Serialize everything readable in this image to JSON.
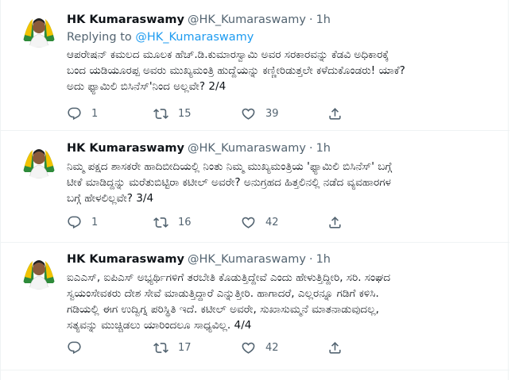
{
  "tweets": [
    {
      "name": "HK Kumaraswamy",
      "handle": "@HK_Kumaraswamy",
      "dot": "·",
      "time": "1h",
      "replying_prefix": "Replying to",
      "replying_to": "@HK_Kumaraswamy",
      "text": "ಆಪರೇಷನ್ ಕಮಲದ ಮೂಲಕ ಹೆಚ್.ಡಿ.ಕುಮಾರಸ್ವಾಮಿ ಅವರ ಸರಕಾರವನ್ನು ಕೆಡವಿ ಅಧಿಕಾರಕ್ಕೆ\nಬಂದ ಯಡಿಯೂರಪ್ಪ ಅವರು ಮುಖ್ಯಮಂತ್ರಿ ಹುದ್ದೆಯನ್ನು ಕಣ್ಣೀರಿಡುತ್ತಲೇ ಕಳೆದುಕೊಂಡರು! ಯಾಕೆ?\nಅದು ಫ್ಯಾಮಿಲಿ ಬಿಸಿನೆಸ್'ನಿಂದ ಅಲ್ಲವೇ? 2/4",
      "replies": "1",
      "retweets": "15",
      "likes": "39"
    },
    {
      "name": "HK Kumaraswamy",
      "handle": "@HK_Kumaraswamy",
      "dot": "·",
      "time": "1h",
      "text": "ನಿಮ್ಮ ಪಕ್ಷದ ಶಾಸಕರೇ ಹಾದಿಬೀದಿಯಲ್ಲಿ ನಿಂತು ನಿಮ್ಮ ಮುಖ್ಯಮಂತ್ರಿಯ 'ಫ್ಯಾಮಿಲಿ ಬಿಸಿನೆಸ್' ಬಗ್ಗೆ\nಟೀಕೆ ಮಾಡಿದ್ದನ್ನು ಮರೆತುಬಿಟ್ಟಿರಾ ಕಟೀಲ್ ಅವರೇ? ಅನುಗ್ರಹದ ಹಿತ್ತಲಿನಲ್ಲಿ ನಡೆದ ವ್ಯವಹಾರಗಳ\nಬಗ್ಗೆ ಹೇಳಲಿಲ್ಲವೇ? 3/4",
      "replies": "1",
      "retweets": "16",
      "likes": "42"
    },
    {
      "name": "HK Kumaraswamy",
      "handle": "@HK_Kumaraswamy",
      "dot": "·",
      "time": "1h",
      "text": "ಐಎಎಸ್, ಐಪಿಎಸ್ ಅಭ್ಯರ್ಥಿಗಳಿಗೆ ತರಬೇತಿ ಕೊಡುತ್ತಿದ್ದೇವೆ ಎಂದು ಹೇಳುತ್ತಿದ್ದೀರಿ, ಸರಿ. ಸಂಘದ\nಸ್ವಯಂಸೇವಕರು ದೇಶ ಸೇವೆ ಮಾಡುತ್ತಿದ್ದಾರೆ ಎನ್ನುತ್ತೀರಿ. ಹಾಗಾದರೆ, ಎಲ್ಲರನ್ನೂ ಗಡಿಗೆ ಕಳಿಸಿ.\nಗಡಿಯಲ್ಲಿ ಈಗ ಉದ್ವಿಗ್ನ ಪರಿಸ್ಥಿತಿ ಇದೆ. ಕಟೀಲ್ ಅವರೇ, ಸುಖಾಸುಮ್ಮನೆ ಮಾತನಾಡುವುದಲ್ಲ,\nಸತ್ಯವನ್ನು ಮುಚ್ಚಿಡಲು ಯಾರಿಂದಲೂ ಸಾಧ್ಯವಿಲ್ಲ. 4/4",
      "replies": "",
      "retweets": "17",
      "likes": "42"
    }
  ]
}
